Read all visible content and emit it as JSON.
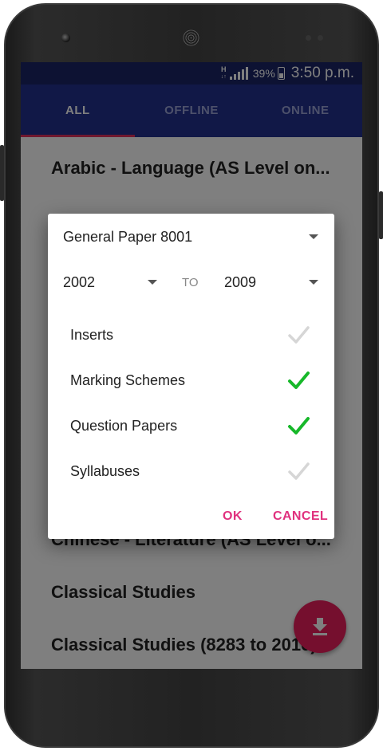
{
  "status": {
    "network_top": "H",
    "network_bottom": "↓↑",
    "battery": "39%",
    "time": "3:50 p.m."
  },
  "tabs": [
    {
      "label": "ALL",
      "active": true
    },
    {
      "label": "OFFLINE",
      "active": false
    },
    {
      "label": "ONLINE",
      "active": false
    }
  ],
  "subjects": [
    "Arabic - Language (AS Level on...",
    "Chinese - Literature (AS Level o...",
    "Classical Studies",
    "Classical Studies (8283 to 2010)"
  ],
  "dialog": {
    "subject": "General Paper 8001",
    "year_from": "2002",
    "to_label": "TO",
    "year_to": "2009",
    "options": [
      {
        "label": "Inserts",
        "checked": false
      },
      {
        "label": "Marking Schemes",
        "checked": true
      },
      {
        "label": "Question Papers",
        "checked": true
      },
      {
        "label": "Syllabuses",
        "checked": false
      }
    ],
    "ok_label": "OK",
    "cancel_label": "CANCEL"
  },
  "colors": {
    "status_bar": "#1b2466",
    "tab_bar": "#23308f",
    "tab_indicator": "#e0315f",
    "accent": "#e0317e",
    "fab": "#ea1f5c",
    "check_on": "#17b82a",
    "check_off": "#d6d6d6"
  },
  "icons": {
    "fab": "download-icon",
    "dropdown": "caret-down-icon",
    "checkbox": "check-icon"
  }
}
